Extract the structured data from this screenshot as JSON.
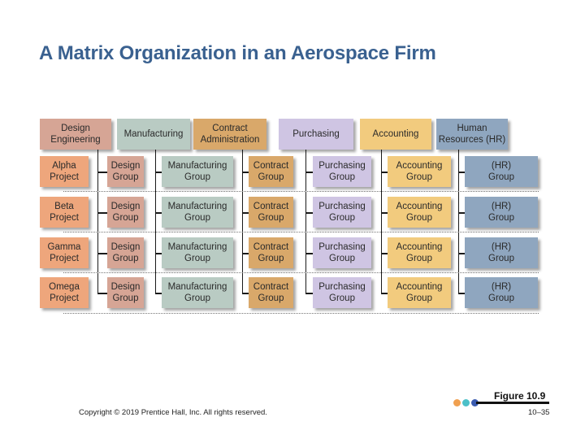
{
  "slide": {
    "title": "A Matrix Organization in an Aerospace Firm",
    "figure_label": "Figure 10.9",
    "copyright": "Copyright © 2019 Prentice Hall, Inc. All rights reserved.",
    "page_number": "10–35"
  },
  "diagram": {
    "functions": [
      {
        "label": "Design\nEngineering",
        "color": "#d6a595"
      },
      {
        "label": "Manufacturing",
        "color": "#b9cbc3"
      },
      {
        "label": "Contract\nAdministration",
        "color": "#d9a86a"
      },
      {
        "label": "Purchasing",
        "color": "#cfc5e3"
      },
      {
        "label": "Accounting",
        "color": "#f2cb7e"
      },
      {
        "label": "Human\nResources (HR)",
        "color": "#8fa6bf"
      }
    ],
    "projects": [
      {
        "label": "Alpha\nProject",
        "color": "#eea67c"
      },
      {
        "label": "Beta\nProject",
        "color": "#eea67c"
      },
      {
        "label": "Gamma\nProject",
        "color": "#eea67c"
      },
      {
        "label": "Omega\nProject",
        "color": "#eea67c"
      }
    ],
    "groups": [
      "Design\nGroup",
      "Manufacturing\nGroup",
      "Contract\nGroup",
      "Purchasing\nGroup",
      "Accounting\nGroup",
      "(HR)\nGroup"
    ]
  },
  "decor": {
    "dot_colors": [
      "#f0a050",
      "#4cc0c8",
      "#3a5bb0"
    ]
  }
}
